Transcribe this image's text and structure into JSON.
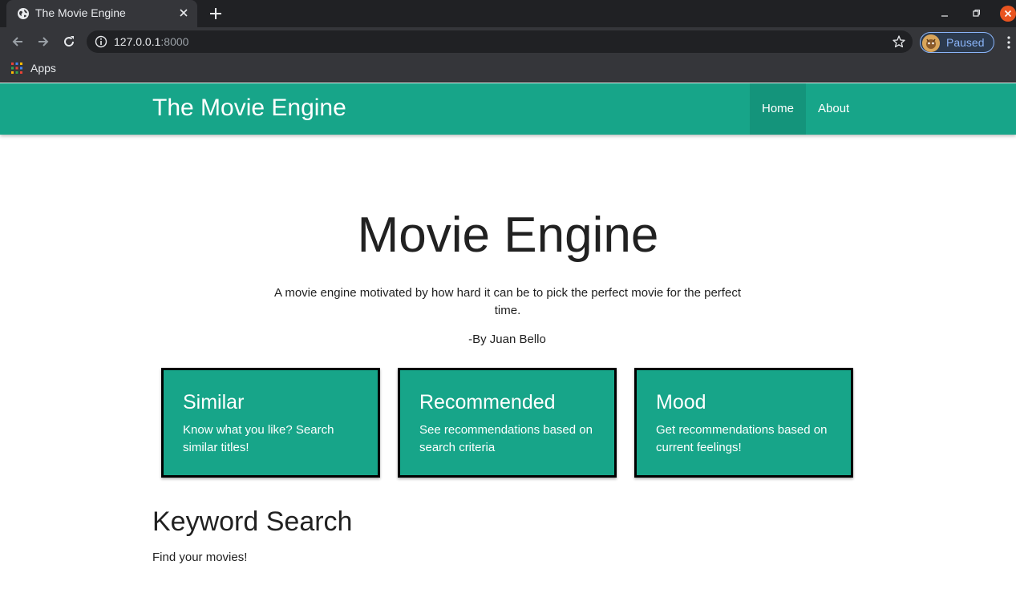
{
  "browser": {
    "tab_title": "The Movie Engine",
    "url_host": "127.0.0.1",
    "url_port": ":8000",
    "profile_status": "Paused",
    "bookmarks_apps": "Apps"
  },
  "navbar": {
    "brand": "The Movie Engine",
    "links": [
      {
        "label": "Home",
        "active": true
      },
      {
        "label": "About",
        "active": false
      }
    ]
  },
  "hero": {
    "title": "Movie Engine",
    "description": "A movie engine motivated by how hard it can be to pick the perfect movie for the perfect time.",
    "author": "-By Juan Bello"
  },
  "cards": [
    {
      "title": "Similar",
      "text": "Know what you like? Search similar titles!"
    },
    {
      "title": "Recommended",
      "text": "See recommendations based on search criteria"
    },
    {
      "title": "Mood",
      "text": "Get recommendations based on current feelings!"
    }
  ],
  "keyword_search": {
    "title": "Keyword Search",
    "subtitle": "Find your movies!"
  },
  "colors": {
    "accent": "#17a589",
    "chrome_dark": "#202124",
    "chrome_mid": "#35363a"
  }
}
